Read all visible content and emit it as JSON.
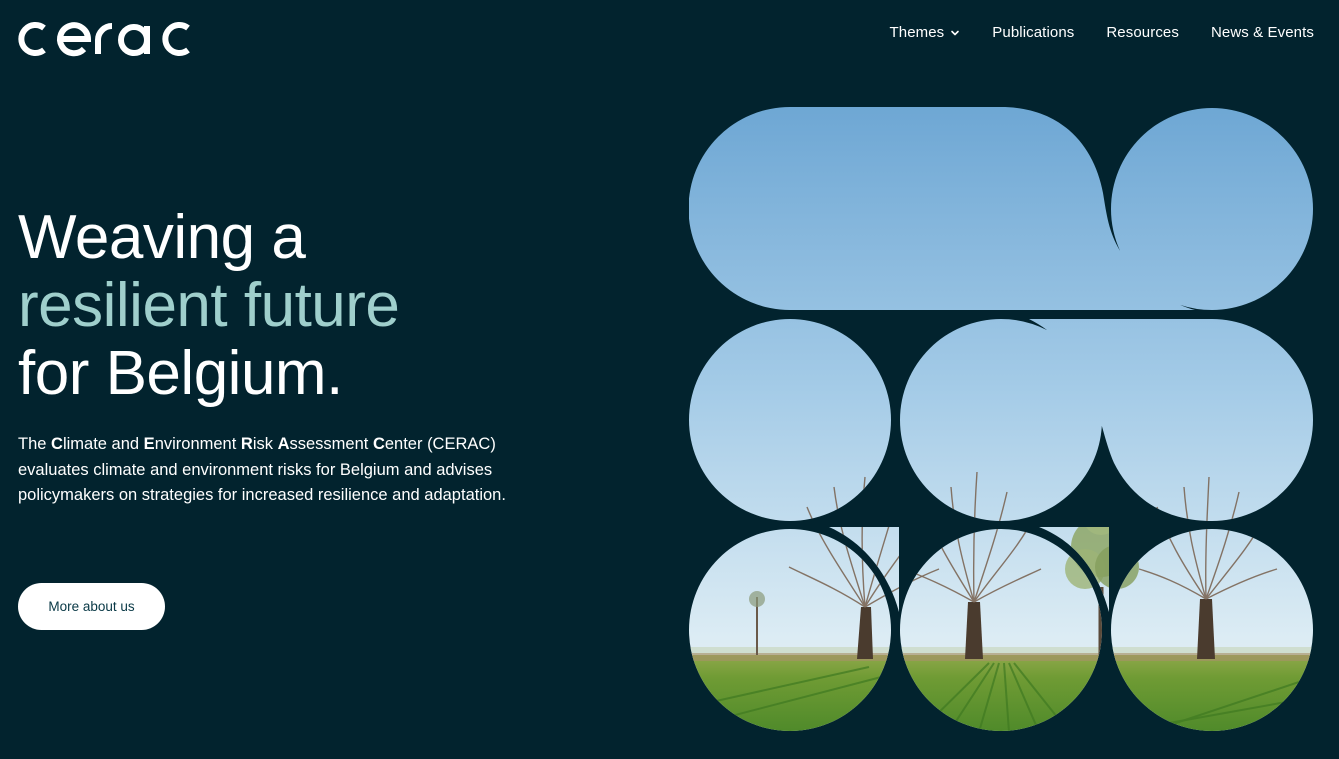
{
  "header": {
    "logo_text": "cerac",
    "nav": [
      {
        "label": "Themes",
        "has_dropdown": true,
        "icon": "chevron-down-icon"
      },
      {
        "label": "Publications"
      },
      {
        "label": "Resources"
      },
      {
        "label": "News & Events"
      }
    ]
  },
  "hero": {
    "title_line1": "Weaving a",
    "title_line2": "resilient future",
    "title_line3": "for Belgium.",
    "description_segments": [
      {
        "text": "The ",
        "bold": false
      },
      {
        "text": "C",
        "bold": true
      },
      {
        "text": "limate and ",
        "bold": false
      },
      {
        "text": "E",
        "bold": true
      },
      {
        "text": "nvironment ",
        "bold": false
      },
      {
        "text": "R",
        "bold": true
      },
      {
        "text": "isk ",
        "bold": false
      },
      {
        "text": "A",
        "bold": true
      },
      {
        "text": "ssessment ",
        "bold": false
      },
      {
        "text": "C",
        "bold": true
      },
      {
        "text": "enter (CERAC) evaluates climate and environment risks for Belgium and advises policymakers on strategies for increased resilience and adaptation.",
        "bold": false
      }
    ],
    "cta_label": "More about us"
  },
  "image": {
    "subject": "pollard willow trees in a green field under a blue sky",
    "icon": "landscape-image"
  },
  "colors": {
    "background": "#02232e",
    "accent_text": "#9fcfcc",
    "button_bg": "#ffffff",
    "button_text": "#083845"
  }
}
